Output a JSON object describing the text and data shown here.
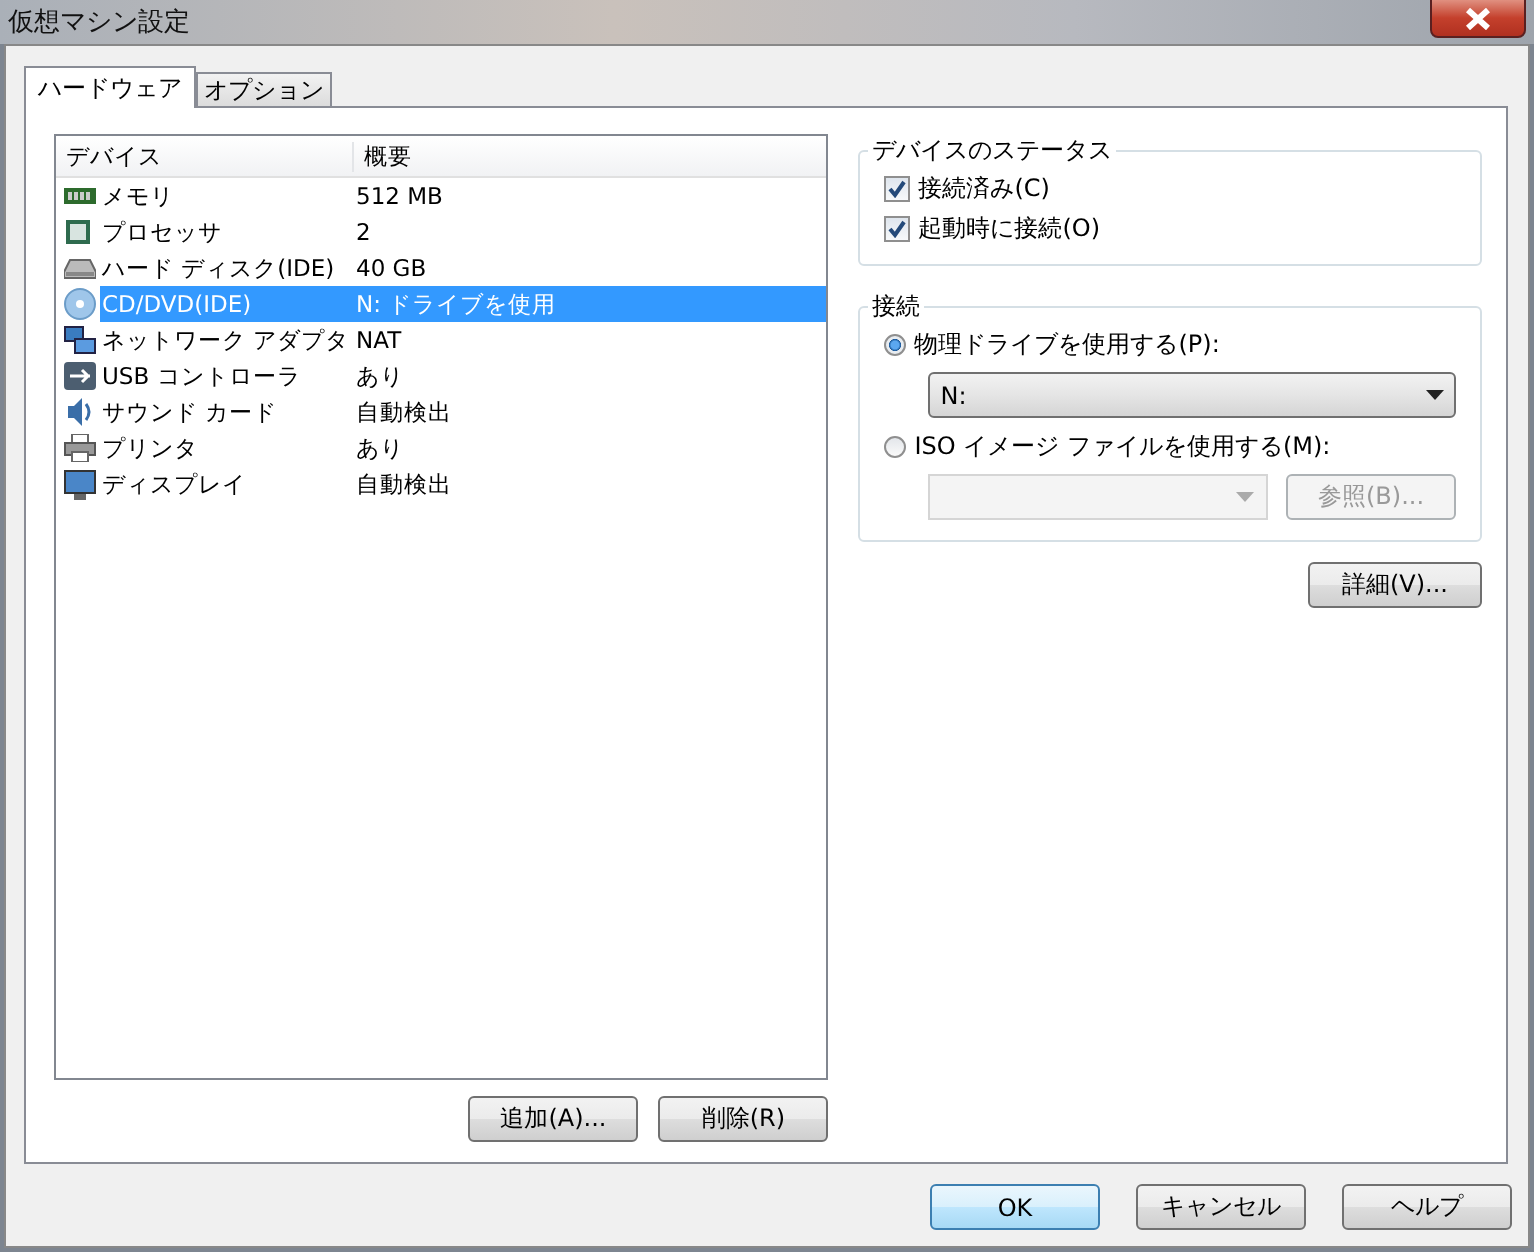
{
  "window": {
    "title": "仮想マシン設定"
  },
  "tabs": [
    {
      "label": "ハードウェア",
      "selected": true
    },
    {
      "label": "オプション",
      "selected": false
    }
  ],
  "device_list": {
    "columns": [
      "デバイス",
      "概要"
    ],
    "rows": [
      {
        "kind": "memory",
        "device": "メモリ",
        "summary": "512 MB",
        "selected": false
      },
      {
        "kind": "processor",
        "device": "プロセッサ",
        "summary": "2",
        "selected": false
      },
      {
        "kind": "disk",
        "device": "ハード ディスク(IDE)",
        "summary": "40 GB",
        "selected": false
      },
      {
        "kind": "cd",
        "device": "CD/DVD(IDE)",
        "summary": "N: ドライブを使用",
        "selected": true
      },
      {
        "kind": "network",
        "device": "ネットワーク アダプタ",
        "summary": "NAT",
        "selected": false
      },
      {
        "kind": "usb",
        "device": "USB コントローラ",
        "summary": "あり",
        "selected": false
      },
      {
        "kind": "sound",
        "device": "サウンド カード",
        "summary": "自動検出",
        "selected": false
      },
      {
        "kind": "printer",
        "device": "プリンタ",
        "summary": "あり",
        "selected": false
      },
      {
        "kind": "display",
        "device": "ディスプレイ",
        "summary": "自動検出",
        "selected": false
      }
    ],
    "buttons": [
      "追加(A)...",
      "削除(R)"
    ]
  },
  "device_status": {
    "title": "デバイスのステータス",
    "options": [
      {
        "label": "接続済み(C)",
        "checked": true
      },
      {
        "label": "起動時に接続(O)",
        "checked": true
      }
    ]
  },
  "connection": {
    "title": "接続",
    "physical": {
      "label": "物理ドライブを使用する(P):",
      "selected": true,
      "drive": "N:"
    },
    "iso": {
      "label": "ISO イメージ ファイルを使用する(M):",
      "selected": false,
      "browse": "参照(B)...",
      "disabled": true
    }
  },
  "advanced_button": "詳細(V)...",
  "footer_buttons": [
    {
      "label": "OK",
      "default": true
    },
    {
      "label": "キャンセル",
      "default": false
    },
    {
      "label": "ヘルプ",
      "default": false
    }
  ]
}
